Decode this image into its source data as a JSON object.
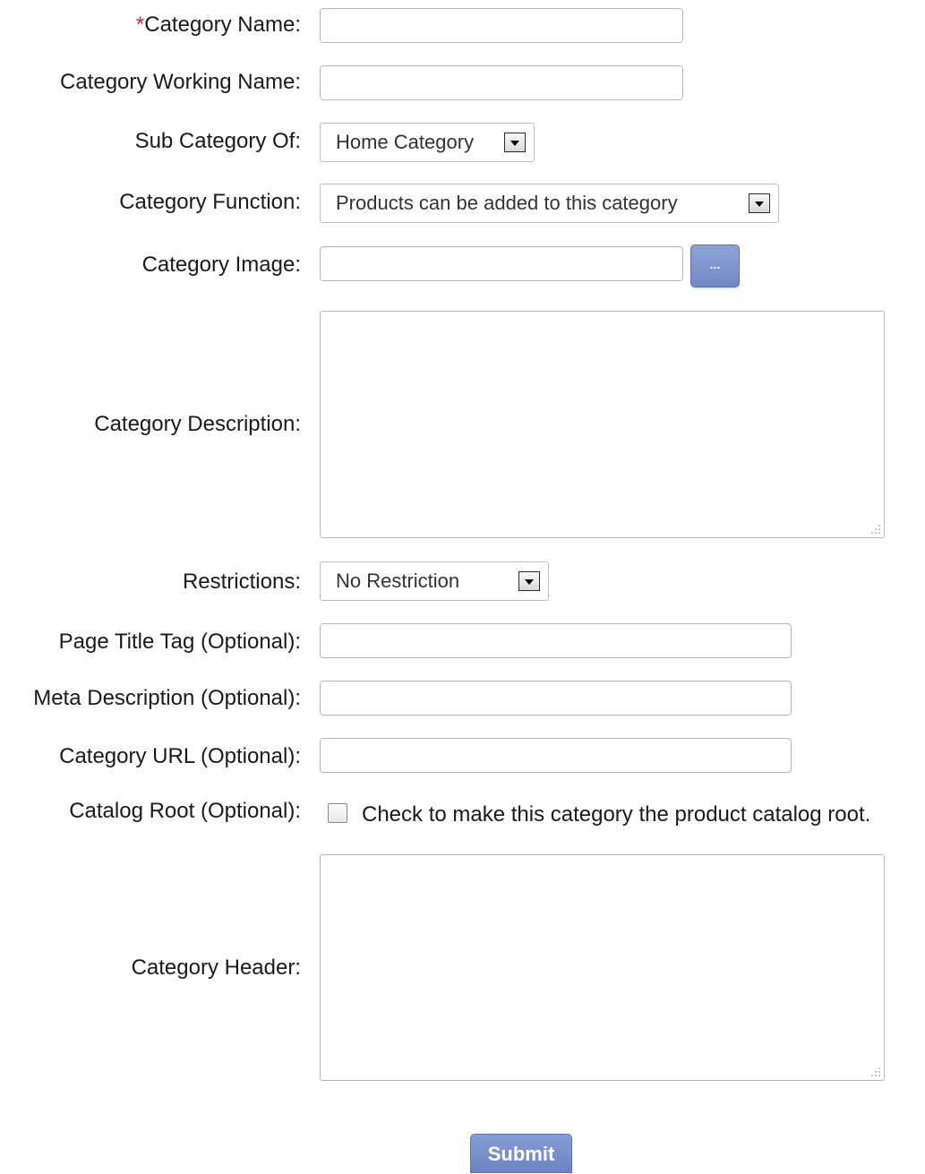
{
  "form": {
    "category_name": {
      "required_marker": "*",
      "label": "Category Name:",
      "value": ""
    },
    "category_working_name": {
      "label": "Category Working Name:",
      "value": ""
    },
    "sub_category_of": {
      "label": "Sub Category Of:",
      "selected": "Home Category"
    },
    "category_function": {
      "label": "Category Function:",
      "selected": "Products can be added to this category"
    },
    "category_image": {
      "label": "Category Image:",
      "value": "",
      "browse_label": "..."
    },
    "category_description": {
      "label": "Category Description:",
      "value": ""
    },
    "restrictions": {
      "label": "Restrictions:",
      "selected": "No Restriction"
    },
    "page_title_tag": {
      "label": "Page Title Tag (Optional):",
      "value": ""
    },
    "meta_description": {
      "label": "Meta Description (Optional):",
      "value": ""
    },
    "category_url": {
      "label": "Category URL (Optional):",
      "value": ""
    },
    "catalog_root": {
      "label": "Catalog Root (Optional):",
      "checked": false,
      "checkbox_text": "Check to make this category the product catalog root."
    },
    "category_header": {
      "label": "Category Header:",
      "value": ""
    },
    "submit_label": "Submit"
  },
  "colors": {
    "required": "#cc2b2b",
    "button": "#6f88c6",
    "border": "#b8b8b8"
  }
}
